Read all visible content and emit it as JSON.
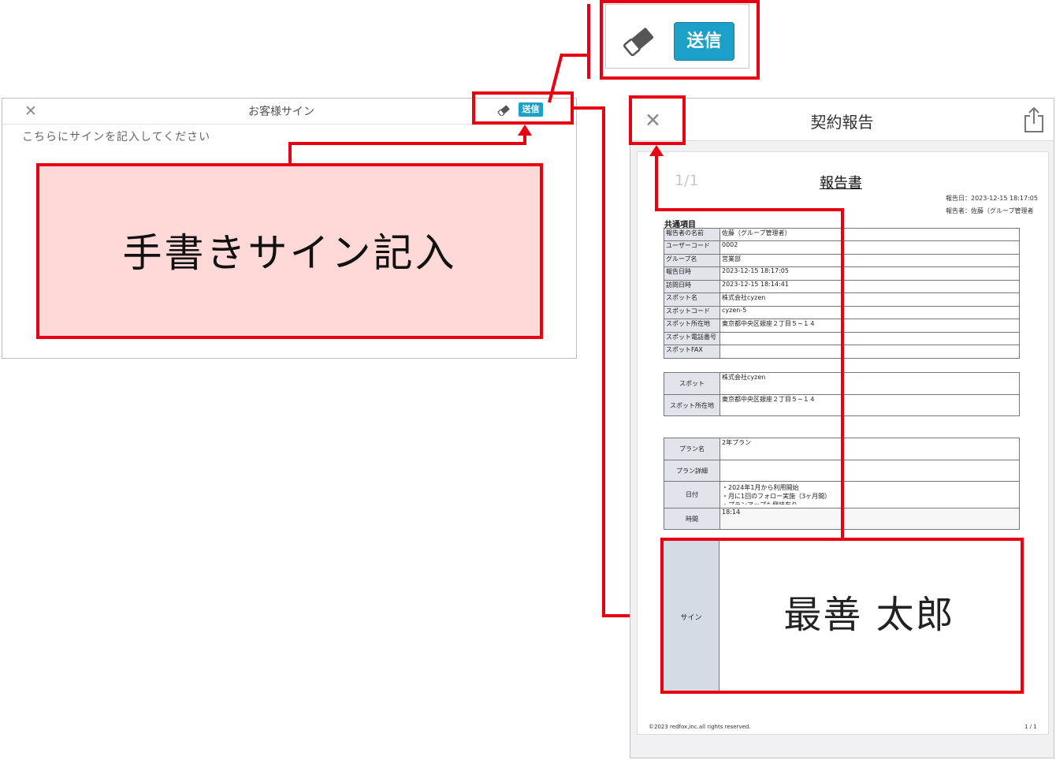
{
  "sign_screen": {
    "close": "✕",
    "title": "お客様サイン",
    "send_label": "送信",
    "placeholder": "こちらにサインを記入してください"
  },
  "callout": {
    "text": "手書きサイン記入"
  },
  "zoom": {
    "send_label": "送信"
  },
  "report_screen": {
    "close": "✕",
    "title": "契約報告",
    "page_indicator": "1/1",
    "doc_title": "報告書",
    "report_date": "報告日：2023-12-15 18:17:05",
    "reporter": "報告者：佐藤（グループ管理者",
    "section_title": "共通項目",
    "common_items": [
      {
        "label": "報告者の名前",
        "value": "佐藤（グループ管理者）"
      },
      {
        "label": "ユーザーコード",
        "value": "0002"
      },
      {
        "label": "グループ名",
        "value": "営業部"
      },
      {
        "label": "報告日時",
        "value": "2023-12-15 18:17:05"
      },
      {
        "label": "訪問日時",
        "value": "2023-12-15 18:14:41"
      },
      {
        "label": "スポット名",
        "value": "株式会社cyzen"
      },
      {
        "label": "スポットコード",
        "value": "cyzen-5"
      },
      {
        "label": "スポット所在地",
        "value": "東京都中央区銀座２丁目５−１４"
      },
      {
        "label": "スポット電話番号",
        "value": ""
      },
      {
        "label": "スポットFAX",
        "value": ""
      }
    ],
    "spot_items": [
      {
        "label": "スポット",
        "value": "株式会社cyzen"
      },
      {
        "label": "スポット所在地",
        "value": "東京都中央区銀座２丁目５−１４"
      }
    ],
    "plan_items": [
      {
        "label": "プラン名",
        "value": "2年プラン"
      },
      {
        "label": "プラン詳細",
        "value": ""
      },
      {
        "label": "日付",
        "value": "・2024年1月から利用開始",
        "value2": "・月に1回のフォロー実施（3ヶ月間）",
        "value3": "・プランアップも興味有り"
      },
      {
        "label": "時間",
        "value": "18:14"
      }
    ],
    "sign_label": "サイン",
    "signature": "最善 太郎",
    "footer_left": "©2023 redfox,inc.all rights reserved.",
    "footer_right": "1 / 1"
  },
  "colors": {
    "accent_red": "#e60012",
    "send_button": "#1da0c8",
    "callout_fill": "#ffd8d8"
  }
}
